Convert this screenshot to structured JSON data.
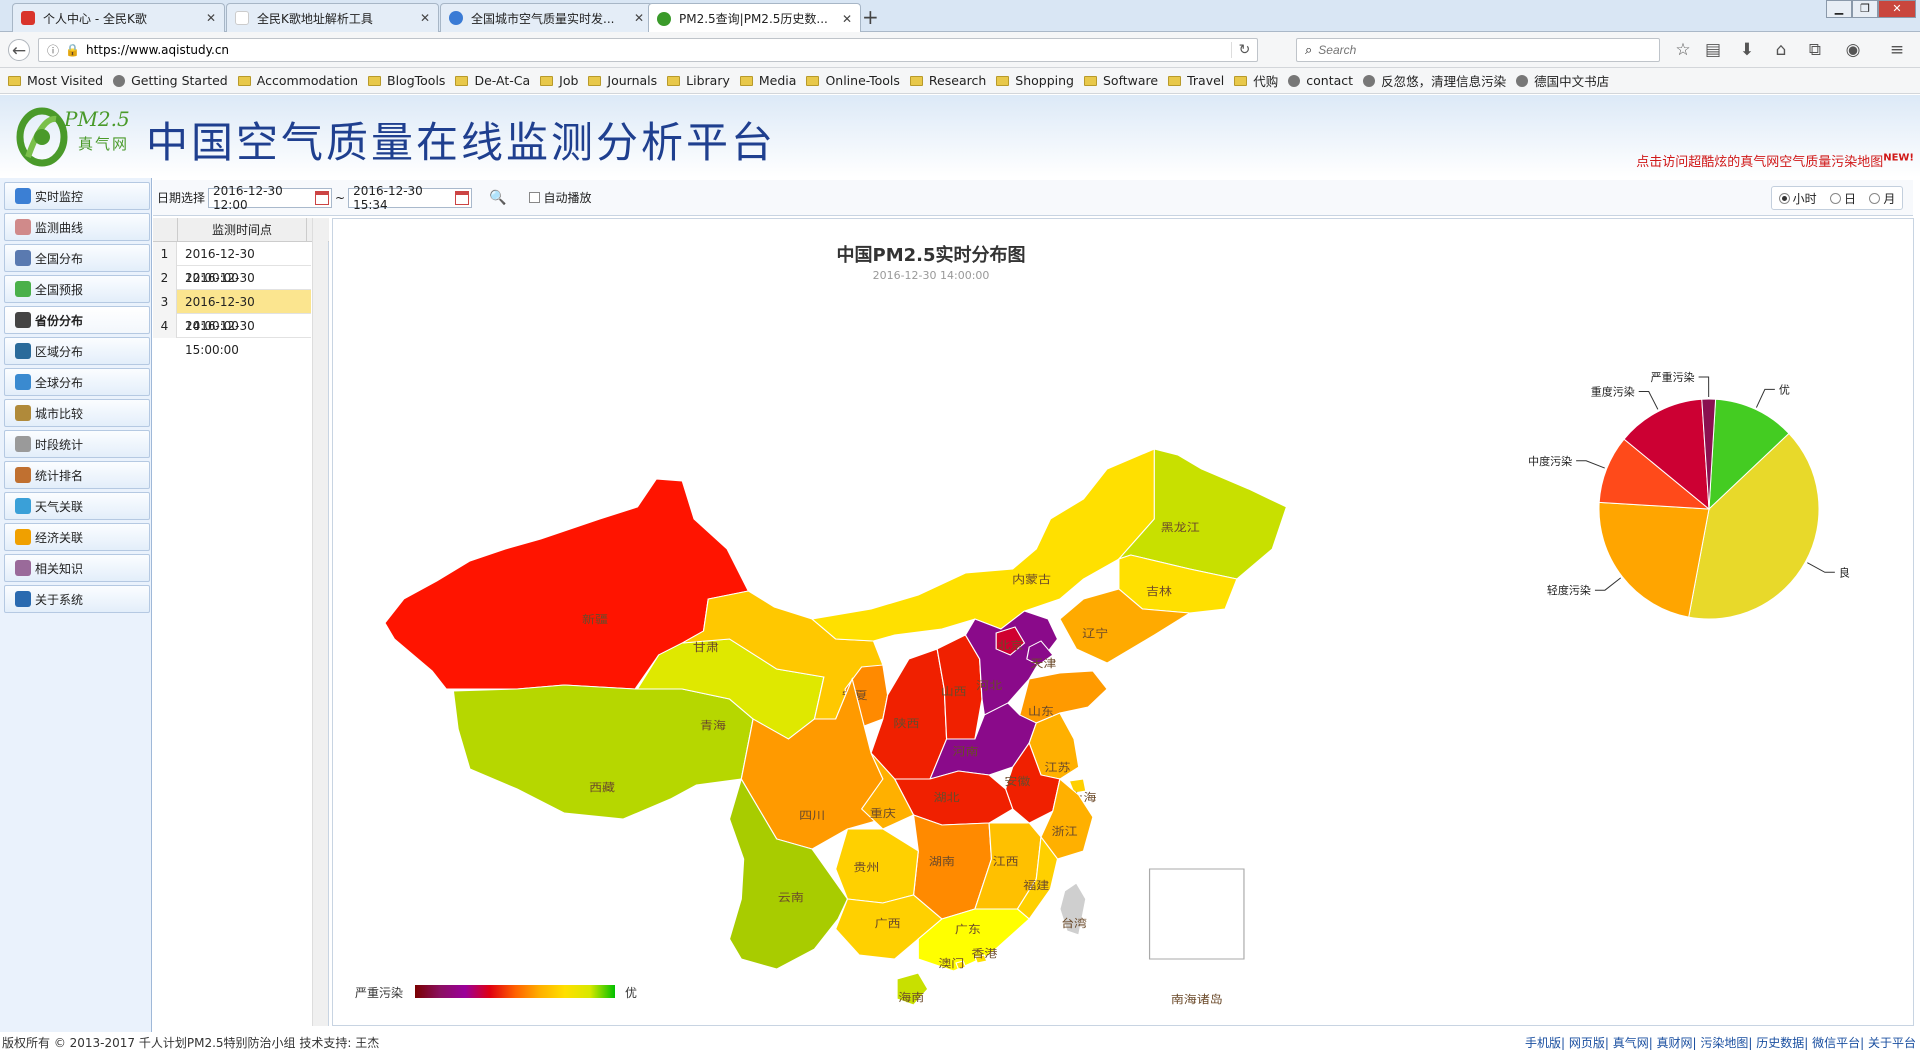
{
  "browser": {
    "tabs": [
      {
        "title": "个人中心 - 全民K歌",
        "color": "#d9342b"
      },
      {
        "title": "全民K歌地址解析工具",
        "color": "#ffffff"
      },
      {
        "title": "全国城市空气质量实时发...",
        "color": "#3a7bd5"
      },
      {
        "title": "PM2.5查询|PM2.5历史数...",
        "color": "#3a9a2a"
      }
    ],
    "new_tab": "+",
    "url": "https://www.aqistudy.cn",
    "search_placeholder": "Search",
    "bookmarks": [
      {
        "label": "Most Visited",
        "type": "folder"
      },
      {
        "label": "Getting Started",
        "type": "globe"
      },
      {
        "label": "Accommodation",
        "type": "folder"
      },
      {
        "label": "BlogTools",
        "type": "folder"
      },
      {
        "label": "De-At-Ca",
        "type": "folder"
      },
      {
        "label": "Job",
        "type": "folder"
      },
      {
        "label": "Journals",
        "type": "folder"
      },
      {
        "label": "Library",
        "type": "folder"
      },
      {
        "label": "Media",
        "type": "folder"
      },
      {
        "label": "Online-Tools",
        "type": "folder"
      },
      {
        "label": "Research",
        "type": "folder"
      },
      {
        "label": "Shopping",
        "type": "folder"
      },
      {
        "label": "Software",
        "type": "folder"
      },
      {
        "label": "Travel",
        "type": "folder"
      },
      {
        "label": "代购",
        "type": "folder"
      },
      {
        "label": "contact",
        "type": "globe"
      },
      {
        "label": "反忽悠，清理信息污染",
        "type": "globe"
      },
      {
        "label": "德国中文书店",
        "type": "globe"
      }
    ]
  },
  "header": {
    "logo_pm": "PM2.5",
    "logo_brand": "真气网",
    "site_title": "中国空气质量在线监测分析平台",
    "map_link": "点击访问超酷炫的真气网空气质量污染地图",
    "map_link_badge": "NEW!"
  },
  "menu": [
    {
      "label": "实时监控",
      "icon": "monitor-icon",
      "color": "#3b7fd4"
    },
    {
      "label": "监测曲线",
      "icon": "curve-icon",
      "color": "#d08a8a"
    },
    {
      "label": "全国分布",
      "icon": "china-map-icon",
      "color": "#5a7ab0"
    },
    {
      "label": "全国预报",
      "icon": "forecast-icon",
      "color": "#4ab04a"
    },
    {
      "label": "省份分布",
      "icon": "province-icon",
      "color": "#444444"
    },
    {
      "label": "区域分布",
      "icon": "region-icon",
      "color": "#2a6a9a"
    },
    {
      "label": "全球分布",
      "icon": "globe-icon",
      "color": "#3a8ad0"
    },
    {
      "label": "城市比较",
      "icon": "city-compare-icon",
      "color": "#b08a3a"
    },
    {
      "label": "时段统计",
      "icon": "clock-icon",
      "color": "#9a9a9a"
    },
    {
      "label": "统计排名",
      "icon": "ranking-icon",
      "color": "#c07030"
    },
    {
      "label": "天气关联",
      "icon": "weather-icon",
      "color": "#3aa0d8"
    },
    {
      "label": "经济关联",
      "icon": "economy-icon",
      "color": "#f0a000"
    },
    {
      "label": "相关知识",
      "icon": "book-icon",
      "color": "#9a6a9a"
    },
    {
      "label": "关于系统",
      "icon": "info-icon",
      "color": "#2a6ab0"
    }
  ],
  "toolbar": {
    "date_label": "日期选择",
    "start": "2016-12-30 12:00",
    "separator": "~",
    "end": "2016-12-30 15:34",
    "autoplay_label": "自动播放",
    "periods": [
      "小时",
      "日",
      "月"
    ],
    "selected_period": "小时"
  },
  "timetable": {
    "header": "监测时间点",
    "rows": [
      {
        "idx": "1",
        "time": "2016-12-30 12:00:00"
      },
      {
        "idx": "2",
        "time": "2016-12-30 13:00:00"
      },
      {
        "idx": "3",
        "time": "2016-12-30 14:00:00"
      },
      {
        "idx": "4",
        "time": "2016-12-30 15:00:00"
      }
    ],
    "selected_index": 2
  },
  "map": {
    "title": "中国PM2.5实时分布图",
    "subtitle": "2016-12-30 14:00:00",
    "legend_low": "严重污染",
    "legend_high": "优",
    "provinces": [
      {
        "name": "新疆",
        "color": "#ff1400"
      },
      {
        "name": "西藏",
        "color": "#b6d700"
      },
      {
        "name": "青海",
        "color": "#dfe800"
      },
      {
        "name": "甘肃",
        "color": "#ffc800"
      },
      {
        "name": "内蒙古",
        "color": "#ffe000"
      },
      {
        "name": "黑龙江",
        "color": "#c8e000"
      },
      {
        "name": "吉林",
        "color": "#ffe000"
      },
      {
        "name": "辽宁",
        "color": "#ffaa00"
      },
      {
        "name": "宁夏",
        "color": "#ff8a00"
      },
      {
        "name": "陕西",
        "color": "#f02000"
      },
      {
        "name": "山西",
        "color": "#f02000"
      },
      {
        "name": "河北",
        "color": "#8a0a8a"
      },
      {
        "name": "北京",
        "color": "#d00030"
      },
      {
        "name": "天津",
        "color": "#8a0a8a"
      },
      {
        "name": "山东",
        "color": "#ff9a00"
      },
      {
        "name": "河南",
        "color": "#8a0a8a"
      },
      {
        "name": "江苏",
        "color": "#ffb000"
      },
      {
        "name": "安徽",
        "color": "#f02000"
      },
      {
        "name": "湖北",
        "color": "#f02000"
      },
      {
        "name": "上海",
        "color": "#ffd000"
      },
      {
        "name": "浙江",
        "color": "#ffb000"
      },
      {
        "name": "四川",
        "color": "#ff9a00"
      },
      {
        "name": "重庆",
        "color": "#ffb000"
      },
      {
        "name": "湖南",
        "color": "#ff8a00"
      },
      {
        "name": "江西",
        "color": "#ffc000"
      },
      {
        "name": "福建",
        "color": "#ffd000"
      },
      {
        "name": "贵州",
        "color": "#ffd000"
      },
      {
        "name": "云南",
        "color": "#a8cc00"
      },
      {
        "name": "广西",
        "color": "#ffd000"
      },
      {
        "name": "广东",
        "color": "#ffff00"
      },
      {
        "name": "香港",
        "color": "#ffe000"
      },
      {
        "name": "澳门",
        "color": "#ffe000"
      },
      {
        "name": "海南",
        "color": "#c8e000"
      },
      {
        "name": "台湾",
        "color": "#cfcfcf"
      },
      {
        "name": "南海诸岛",
        "color": "#cfcfcf"
      }
    ]
  },
  "pie": {
    "slices": [
      {
        "name": "优",
        "value": 12,
        "color": "#44cc22"
      },
      {
        "name": "良",
        "value": 40,
        "color": "#e8d92a"
      },
      {
        "name": "轻度污染",
        "value": 23,
        "color": "#ffa500"
      },
      {
        "name": "中度污染",
        "value": 10,
        "color": "#ff4a1a"
      },
      {
        "name": "重度污染",
        "value": 13,
        "color": "#cc0033"
      },
      {
        "name": "严重污染",
        "value": 2,
        "color": "#8a1050"
      }
    ]
  },
  "footer": {
    "copyright": "版权所有 © 2013-2017 千人计划PM2.5特别防治小组 技术支持: 王杰",
    "links": "手机版| 网页版| 真气网| 真财网| 污染地图| 历史数据| 微信平台| 关于平台"
  }
}
